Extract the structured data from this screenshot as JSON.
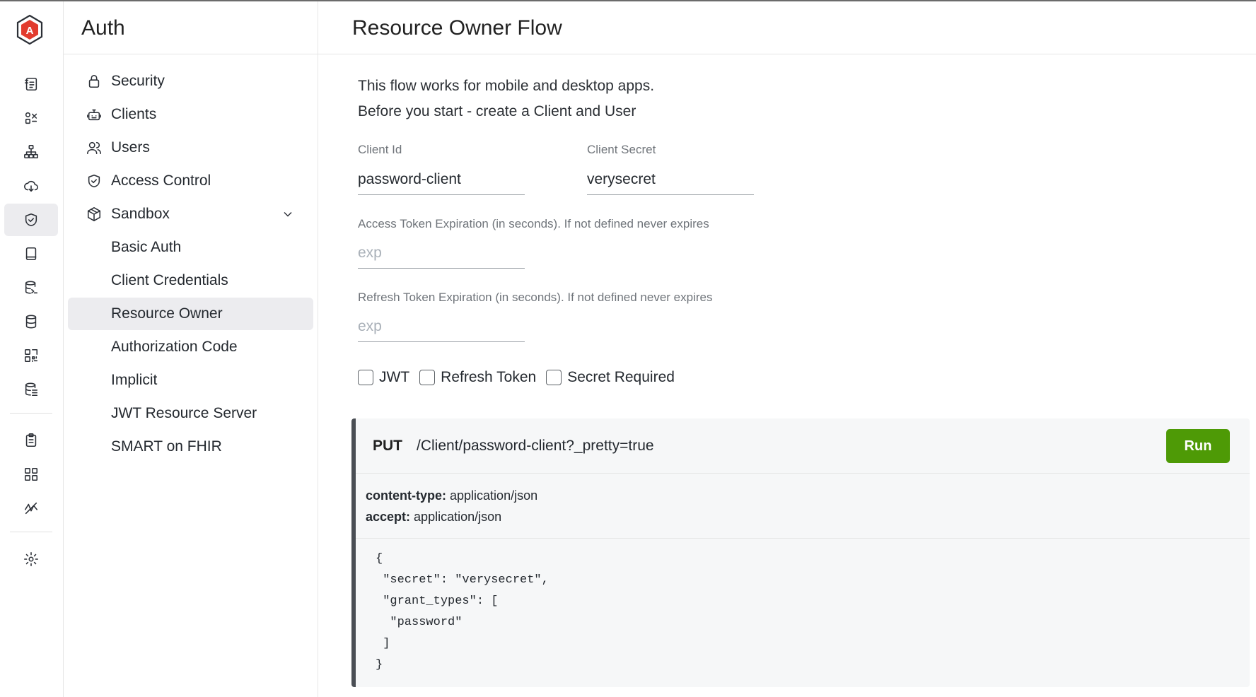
{
  "rail": {
    "items": [
      {
        "name": "api-console-icon"
      },
      {
        "name": "rest-console-icon"
      },
      {
        "name": "hierarchy-icon"
      },
      {
        "name": "cloud-icon"
      },
      {
        "name": "shield-icon",
        "active": true
      },
      {
        "name": "book-icon"
      },
      {
        "name": "db-console-icon"
      },
      {
        "name": "database-icon"
      },
      {
        "name": "qr-icon"
      },
      {
        "name": "db-list-icon"
      },
      {
        "name": "clipboard-icon"
      },
      {
        "name": "apps-grid-icon"
      },
      {
        "name": "analytics-icon"
      },
      {
        "name": "settings-icon"
      }
    ]
  },
  "sidebar": {
    "title": "Auth",
    "items": [
      {
        "label": "Security",
        "icon": "lock-icon"
      },
      {
        "label": "Clients",
        "icon": "robot-icon"
      },
      {
        "label": "Users",
        "icon": "users-icon"
      },
      {
        "label": "Access Control",
        "icon": "shield-check-icon"
      },
      {
        "label": "Sandbox",
        "icon": "cube-icon",
        "expanded": true
      }
    ],
    "sandbox_items": [
      {
        "label": "Basic Auth"
      },
      {
        "label": "Client Credentials"
      },
      {
        "label": "Resource Owner",
        "active": true
      },
      {
        "label": "Authorization Code"
      },
      {
        "label": "Implicit"
      },
      {
        "label": "JWT Resource Server"
      },
      {
        "label": "SMART on FHIR"
      }
    ]
  },
  "main": {
    "title": "Resource Owner Flow",
    "intro_line1": "This flow works for mobile and desktop apps.",
    "intro_line2": "Before you start - create a Client and User",
    "client_id": {
      "label": "Client Id",
      "value": "password-client"
    },
    "client_secret": {
      "label": "Client Secret",
      "value": "verysecret"
    },
    "access_exp": {
      "label": "Access Token Expiration (in seconds). If not defined never expires",
      "placeholder": "exp",
      "value": ""
    },
    "refresh_exp": {
      "label": "Refresh Token Expiration (in seconds). If not defined never expires",
      "placeholder": "exp",
      "value": ""
    },
    "checkboxes": [
      {
        "label": "JWT",
        "checked": false
      },
      {
        "label": "Refresh Token",
        "checked": false
      },
      {
        "label": "Secret Required",
        "checked": false
      }
    ]
  },
  "request": {
    "method": "PUT",
    "url": "/Client/password-client?_pretty=true",
    "run_label": "Run",
    "headers": [
      {
        "key": "content-type:",
        "value": "application/json"
      },
      {
        "key": "accept:",
        "value": "application/json"
      }
    ],
    "body": "{\n \"secret\": \"verysecret\",\n \"grant_types\": [\n  \"password\"\n ]\n}"
  },
  "colors": {
    "accent": "#4e9a06",
    "active_bg": "#ececef",
    "logo": "#e23b2e"
  }
}
